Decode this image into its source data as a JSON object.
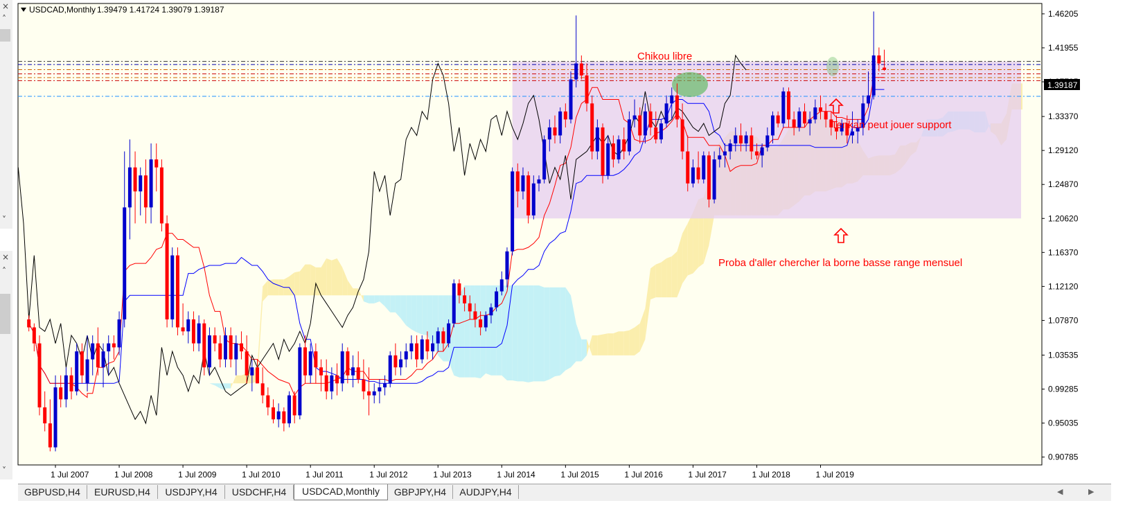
{
  "header": {
    "symbol_label": "USDCAD,Monthly",
    "ohlc": "1.39479 1.41724 1.39079 1.39187"
  },
  "price_tag": "1.39187",
  "annotations": {
    "chikou": "Chikou libre",
    "tenkan": "Tenkan peut jouer support",
    "proba": "Proba d'aller chercher la borne basse range mensuel"
  },
  "tabs": [
    "GBPUSD,H4",
    "EURUSD,H4",
    "USDJPY,H4",
    "USDCHF,H4",
    "USDCAD,Monthly",
    "GBPJPY,H4",
    "AUDJPY,H4"
  ],
  "active_tab": "USDCAD,Monthly",
  "side_glyphs": {
    "close": "×",
    "up": "˄",
    "down": "˅"
  },
  "colors": {
    "background": "#fffff0",
    "bull": "#0000cc",
    "bear": "#ff0000",
    "tenkan": "#ff0000",
    "kijun": "#0000ff",
    "chikou": "#000000",
    "cloud_bull": "#fbeead",
    "cloud_bear": "#c4f1f6",
    "range_box": "#e6cdf0",
    "chikou_circle": "#5cb85c"
  },
  "chart_data": {
    "type": "candlestick",
    "title": "USDCAD,Monthly",
    "y_ticks": [
      "1.46205",
      "1.41955",
      "1.37705",
      "1.33370",
      "1.29120",
      "1.24870",
      "1.20620",
      "1.16370",
      "1.12120",
      "1.07870",
      "1.03535",
      "0.99285",
      "0.95035",
      "0.90785"
    ],
    "x_ticks": [
      "1 Jul 2007",
      "1 Jul 2008",
      "1 Jul 2009",
      "1 Jul 2010",
      "1 Jul 2011",
      "1 Jul 2012",
      "1 Jul 2013",
      "1 Jul 2014",
      "1 Jul 2015",
      "1 Jul 2016",
      "1 Jul 2017",
      "1 Jul 2018",
      "1 Jul 2019"
    ],
    "ylim": [
      0.898,
      1.475
    ],
    "candles": [
      [
        "2007-02",
        1.08,
        1.085,
        1.065,
        1.07
      ],
      [
        "2007-03",
        1.07,
        1.075,
        1.04,
        1.05
      ],
      [
        "2007-04",
        1.05,
        1.06,
        0.96,
        0.97
      ],
      [
        "2007-05",
        0.97,
        0.99,
        0.94,
        0.95
      ],
      [
        "2007-06",
        0.95,
        0.98,
        0.915,
        0.92
      ],
      [
        "2007-07",
        0.92,
        1.01,
        0.915,
        0.995
      ],
      [
        "2007-08",
        0.995,
        1.01,
        0.97,
        0.98
      ],
      [
        "2007-09",
        0.98,
        1.02,
        0.97,
        1.01
      ],
      [
        "2007-10",
        1.01,
        1.02,
        0.98,
        0.99
      ],
      [
        "2007-11",
        0.99,
        1.05,
        0.985,
        1.04
      ],
      [
        "2007-12",
        1.04,
        1.05,
        1.0,
        1.01
      ],
      [
        "2007-13",
        1.01,
        1.03,
        0.99,
        1.0
      ],
      [
        "2008-01",
        1.0,
        1.06,
        0.99,
        1.03
      ],
      [
        "2008-02",
        1.03,
        1.06,
        1.01,
        1.05
      ],
      [
        "2008-03",
        1.05,
        1.07,
        1.01,
        1.02
      ],
      [
        "2008-04",
        1.02,
        1.05,
        0.995,
        1.04
      ],
      [
        "2008-05",
        1.04,
        1.06,
        1.01,
        1.05
      ],
      [
        "2008-06",
        1.05,
        1.06,
        1.03,
        1.045
      ],
      [
        "2008-07",
        1.045,
        1.09,
        1.035,
        1.08
      ],
      [
        "2008-08",
        1.08,
        1.29,
        1.07,
        1.22
      ],
      [
        "2008-09",
        1.22,
        1.305,
        1.18,
        1.27
      ],
      [
        "2008-10",
        1.27,
        1.29,
        1.2,
        1.24
      ],
      [
        "2008-11",
        1.24,
        1.27,
        1.21,
        1.26
      ],
      [
        "2008-12",
        1.26,
        1.28,
        1.2,
        1.22
      ],
      [
        "2009-01",
        1.22,
        1.3,
        1.2,
        1.28
      ],
      [
        "2009-02",
        1.28,
        1.3,
        1.24,
        1.27
      ],
      [
        "2009-03",
        1.27,
        1.28,
        1.19,
        1.2
      ],
      [
        "2009-04",
        1.2,
        1.21,
        1.07,
        1.08
      ],
      [
        "2009-05",
        1.08,
        1.17,
        1.07,
        1.16
      ],
      [
        "2009-06",
        1.16,
        1.17,
        1.06,
        1.07
      ],
      [
        "2009-07",
        1.07,
        1.1,
        1.06,
        1.065
      ],
      [
        "2009-08",
        1.065,
        1.09,
        1.05,
        1.08
      ],
      [
        "2009-09",
        1.08,
        1.09,
        1.04,
        1.05
      ],
      [
        "2009-10",
        1.05,
        1.085,
        1.04,
        1.075
      ],
      [
        "2009-11",
        1.075,
        1.08,
        1.01,
        1.02
      ],
      [
        "2009-12",
        1.02,
        1.07,
        1.01,
        1.06
      ],
      [
        "2010-01",
        1.06,
        1.07,
        1.04,
        1.05
      ],
      [
        "2010-02",
        1.05,
        1.06,
        1.02,
        1.03
      ],
      [
        "2010-03",
        1.03,
        1.07,
        1.02,
        1.06
      ],
      [
        "2010-04",
        1.06,
        1.07,
        1.02,
        1.03
      ],
      [
        "2010-05",
        1.03,
        1.06,
        1.01,
        1.05
      ],
      [
        "2010-06",
        1.05,
        1.065,
        1.03,
        1.04
      ],
      [
        "2010-07",
        1.04,
        1.06,
        1.0,
        1.01
      ],
      [
        "2010-08",
        1.01,
        1.03,
        0.99,
        1.02
      ],
      [
        "2010-09",
        1.02,
        1.03,
        1.0,
        1.0
      ],
      [
        "2010-10",
        1.0,
        1.02,
        0.975,
        0.985
      ],
      [
        "2010-11",
        0.985,
        0.995,
        0.96,
        0.97
      ],
      [
        "2010-12",
        0.97,
        0.98,
        0.95,
        0.955
      ],
      [
        "2011-01",
        0.955,
        0.975,
        0.945,
        0.965
      ],
      [
        "2011-02",
        0.965,
        0.97,
        0.94,
        0.95
      ],
      [
        "2011-03",
        0.95,
        0.99,
        0.945,
        0.985
      ],
      [
        "2011-04",
        0.985,
        0.99,
        0.95,
        0.96
      ],
      [
        "2011-05",
        0.96,
        1.05,
        0.955,
        1.045
      ],
      [
        "2011-06",
        1.045,
        1.06,
        1.0,
        1.01
      ],
      [
        "2011-07",
        1.01,
        1.05,
        1.0,
        1.04
      ],
      [
        "2011-08",
        1.04,
        1.05,
        1.0,
        1.02
      ],
      [
        "2011-09",
        1.02,
        1.03,
        0.99,
        1.01
      ],
      [
        "2011-10",
        1.01,
        1.03,
        0.98,
        0.99
      ],
      [
        "2011-11",
        0.99,
        1.02,
        0.98,
        1.01
      ],
      [
        "2011-12",
        1.01,
        1.025,
        0.985,
        1.0
      ],
      [
        "2012-01",
        1.0,
        1.05,
        0.99,
        1.04
      ],
      [
        "2012-02",
        1.04,
        1.045,
        1.0,
        1.01
      ],
      [
        "2012-03",
        1.01,
        1.035,
        0.995,
        1.02
      ],
      [
        "2012-04",
        1.02,
        1.04,
        1.0,
        1.005
      ],
      [
        "2012-05",
        1.005,
        1.03,
        0.98,
        0.99
      ],
      [
        "2012-06",
        0.99,
        1.02,
        0.96,
        0.985
      ],
      [
        "2012-07",
        0.985,
        1.0,
        0.975,
        0.99
      ],
      [
        "2012-08",
        0.99,
        1.005,
        0.975,
        0.995
      ],
      [
        "2012-09",
        0.995,
        1.01,
        0.985,
        1.0
      ],
      [
        "2012-10",
        1.0,
        1.04,
        0.995,
        1.035
      ],
      [
        "2012-11",
        1.035,
        1.05,
        1.01,
        1.02
      ],
      [
        "2012-12",
        1.02,
        1.04,
        1.01,
        1.03
      ],
      [
        "2013-01",
        1.03,
        1.05,
        1.02,
        1.04
      ],
      [
        "2013-02",
        1.04,
        1.06,
        1.03,
        1.05
      ],
      [
        "2013-03",
        1.05,
        1.06,
        1.02,
        1.03
      ],
      [
        "2013-04",
        1.03,
        1.06,
        1.025,
        1.055
      ],
      [
        "2013-05",
        1.055,
        1.065,
        1.03,
        1.04
      ],
      [
        "2013-06",
        1.04,
        1.06,
        1.03,
        1.05
      ],
      [
        "2013-07",
        1.05,
        1.07,
        1.04,
        1.065
      ],
      [
        "2013-08",
        1.065,
        1.07,
        1.04,
        1.05
      ],
      [
        "2013-09",
        1.05,
        1.08,
        1.045,
        1.075
      ],
      [
        "2013-10",
        1.075,
        1.13,
        1.07,
        1.125
      ],
      [
        "2013-11",
        1.125,
        1.13,
        1.1,
        1.11
      ],
      [
        "2013-12",
        1.11,
        1.12,
        1.09,
        1.1
      ],
      [
        "2014-01",
        1.1,
        1.11,
        1.08,
        1.09
      ],
      [
        "2014-02",
        1.09,
        1.1,
        1.07,
        1.08
      ],
      [
        "2014-03",
        1.08,
        1.09,
        1.06,
        1.07
      ],
      [
        "2014-04",
        1.07,
        1.09,
        1.065,
        1.085
      ],
      [
        "2014-05",
        1.085,
        1.1,
        1.075,
        1.095
      ],
      [
        "2014-06",
        1.095,
        1.12,
        1.09,
        1.115
      ],
      [
        "2014-07",
        1.115,
        1.14,
        1.11,
        1.13
      ],
      [
        "2014-08",
        1.13,
        1.17,
        1.12,
        1.165
      ],
      [
        "2014-09",
        1.165,
        1.27,
        1.16,
        1.265
      ],
      [
        "2014-10",
        1.265,
        1.275,
        1.22,
        1.24
      ],
      [
        "2014-11",
        1.24,
        1.27,
        1.23,
        1.26
      ],
      [
        "2014-12",
        1.26,
        1.265,
        1.2,
        1.21
      ],
      [
        "2015-01",
        1.21,
        1.26,
        1.205,
        1.25
      ],
      [
        "2015-02",
        1.25,
        1.26,
        1.24,
        1.255
      ],
      [
        "2015-03",
        1.255,
        1.31,
        1.25,
        1.305
      ],
      [
        "2015-04",
        1.305,
        1.33,
        1.29,
        1.32
      ],
      [
        "2015-05",
        1.32,
        1.335,
        1.3,
        1.31
      ],
      [
        "2015-06",
        1.31,
        1.345,
        1.3,
        1.34
      ],
      [
        "2015-07",
        1.34,
        1.35,
        1.32,
        1.33
      ],
      [
        "2015-08",
        1.33,
        1.39,
        1.325,
        1.38
      ],
      [
        "2015-09",
        1.38,
        1.46,
        1.37,
        1.4
      ],
      [
        "2015-10",
        1.4,
        1.41,
        1.38,
        1.385
      ],
      [
        "2015-11",
        1.385,
        1.4,
        1.34,
        1.35
      ],
      [
        "2015-12",
        1.35,
        1.36,
        1.28,
        1.29
      ],
      [
        "2016-01",
        1.29,
        1.33,
        1.28,
        1.32
      ],
      [
        "2016-02",
        1.32,
        1.325,
        1.25,
        1.26
      ],
      [
        "2016-03",
        1.26,
        1.31,
        1.255,
        1.3
      ],
      [
        "2016-04",
        1.3,
        1.31,
        1.27,
        1.28
      ],
      [
        "2016-05",
        1.28,
        1.31,
        1.275,
        1.305
      ],
      [
        "2016-06",
        1.305,
        1.32,
        1.28,
        1.29
      ],
      [
        "2016-07",
        1.29,
        1.34,
        1.285,
        1.33
      ],
      [
        "2016-08",
        1.33,
        1.355,
        1.32,
        1.335
      ],
      [
        "2016-09",
        1.335,
        1.345,
        1.3,
        1.31
      ],
      [
        "2016-10",
        1.31,
        1.35,
        1.3,
        1.34
      ],
      [
        "2016-11",
        1.34,
        1.35,
        1.31,
        1.32
      ],
      [
        "2016-12",
        1.32,
        1.34,
        1.3,
        1.305
      ],
      [
        "2017-01",
        1.305,
        1.33,
        1.3,
        1.325
      ],
      [
        "2017-02",
        1.325,
        1.36,
        1.32,
        1.35
      ],
      [
        "2017-03",
        1.35,
        1.37,
        1.33,
        1.36
      ],
      [
        "2017-04",
        1.36,
        1.375,
        1.32,
        1.33
      ],
      [
        "2017-05",
        1.33,
        1.35,
        1.28,
        1.29
      ],
      [
        "2017-06",
        1.29,
        1.31,
        1.24,
        1.25
      ],
      [
        "2017-07",
        1.25,
        1.28,
        1.245,
        1.27
      ],
      [
        "2017-08",
        1.27,
        1.29,
        1.25,
        1.255
      ],
      [
        "2017-09",
        1.255,
        1.29,
        1.25,
        1.285
      ],
      [
        "2017-10",
        1.285,
        1.29,
        1.22,
        1.23
      ],
      [
        "2017-11",
        1.23,
        1.29,
        1.225,
        1.28
      ],
      [
        "2017-12",
        1.28,
        1.295,
        1.27,
        1.285
      ],
      [
        "2018-01",
        1.285,
        1.3,
        1.27,
        1.29
      ],
      [
        "2018-02",
        1.29,
        1.305,
        1.28,
        1.3
      ],
      [
        "2018-03",
        1.3,
        1.32,
        1.29,
        1.31
      ],
      [
        "2018-04",
        1.31,
        1.325,
        1.29,
        1.3
      ],
      [
        "2018-05",
        1.3,
        1.315,
        1.29,
        1.31
      ],
      [
        "2018-06",
        1.31,
        1.32,
        1.28,
        1.29
      ],
      [
        "2018-07",
        1.29,
        1.3,
        1.28,
        1.285
      ],
      [
        "2018-08",
        1.285,
        1.3,
        1.27,
        1.295
      ],
      [
        "2018-09",
        1.295,
        1.32,
        1.29,
        1.31
      ],
      [
        "2018-10",
        1.31,
        1.34,
        1.3,
        1.335
      ],
      [
        "2018-11",
        1.335,
        1.34,
        1.32,
        1.325
      ],
      [
        "2018-12",
        1.325,
        1.37,
        1.32,
        1.365
      ],
      [
        "2019-01",
        1.365,
        1.37,
        1.32,
        1.33
      ],
      [
        "2019-02",
        1.33,
        1.34,
        1.31,
        1.32
      ],
      [
        "2019-03",
        1.32,
        1.345,
        1.315,
        1.34
      ],
      [
        "2019-04",
        1.34,
        1.35,
        1.32,
        1.325
      ],
      [
        "2019-05",
        1.325,
        1.34,
        1.31,
        1.33
      ],
      [
        "2019-06",
        1.33,
        1.355,
        1.325,
        1.345
      ],
      [
        "2019-07",
        1.345,
        1.36,
        1.33,
        1.34
      ],
      [
        "2019-08",
        1.34,
        1.35,
        1.32,
        1.33
      ],
      [
        "2019-09",
        1.33,
        1.34,
        1.31,
        1.32
      ],
      [
        "2019-10",
        1.32,
        1.335,
        1.305,
        1.315
      ],
      [
        "2019-11",
        1.315,
        1.33,
        1.31,
        1.325
      ],
      [
        "2019-12",
        1.325,
        1.335,
        1.3,
        1.31
      ],
      [
        "2020-01",
        1.31,
        1.34,
        1.3,
        1.315
      ],
      [
        "2020-02",
        1.315,
        1.33,
        1.3,
        1.32
      ],
      [
        "2020-03",
        1.32,
        1.36,
        1.31,
        1.35
      ],
      [
        "2020-04",
        1.35,
        1.39,
        1.345,
        1.36
      ],
      [
        "2020-05",
        1.36,
        1.465,
        1.355,
        1.41
      ],
      [
        "2020-06",
        1.41,
        1.42,
        1.39,
        1.4
      ],
      [
        "2020-07",
        1.39479,
        1.41724,
        1.39079,
        1.39187
      ]
    ],
    "horizontal_levels": [
      1.4025,
      1.3987,
      1.3923,
      1.387,
      1.3823,
      1.3785,
      1.3589
    ],
    "range_box": {
      "x_from": "2014-09",
      "x_to": "2022-12",
      "y_from": 1.2062,
      "y_to": 1.4025
    }
  }
}
